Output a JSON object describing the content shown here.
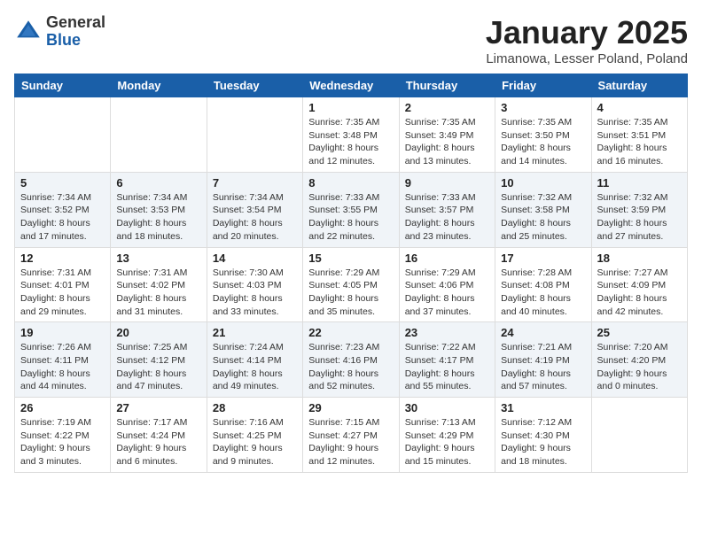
{
  "header": {
    "logo_general": "General",
    "logo_blue": "Blue",
    "title": "January 2025",
    "location": "Limanowa, Lesser Poland, Poland"
  },
  "days_of_week": [
    "Sunday",
    "Monday",
    "Tuesday",
    "Wednesday",
    "Thursday",
    "Friday",
    "Saturday"
  ],
  "weeks": [
    [
      {
        "day": "",
        "info": ""
      },
      {
        "day": "",
        "info": ""
      },
      {
        "day": "",
        "info": ""
      },
      {
        "day": "1",
        "info": "Sunrise: 7:35 AM\nSunset: 3:48 PM\nDaylight: 8 hours\nand 12 minutes."
      },
      {
        "day": "2",
        "info": "Sunrise: 7:35 AM\nSunset: 3:49 PM\nDaylight: 8 hours\nand 13 minutes."
      },
      {
        "day": "3",
        "info": "Sunrise: 7:35 AM\nSunset: 3:50 PM\nDaylight: 8 hours\nand 14 minutes."
      },
      {
        "day": "4",
        "info": "Sunrise: 7:35 AM\nSunset: 3:51 PM\nDaylight: 8 hours\nand 16 minutes."
      }
    ],
    [
      {
        "day": "5",
        "info": "Sunrise: 7:34 AM\nSunset: 3:52 PM\nDaylight: 8 hours\nand 17 minutes."
      },
      {
        "day": "6",
        "info": "Sunrise: 7:34 AM\nSunset: 3:53 PM\nDaylight: 8 hours\nand 18 minutes."
      },
      {
        "day": "7",
        "info": "Sunrise: 7:34 AM\nSunset: 3:54 PM\nDaylight: 8 hours\nand 20 minutes."
      },
      {
        "day": "8",
        "info": "Sunrise: 7:33 AM\nSunset: 3:55 PM\nDaylight: 8 hours\nand 22 minutes."
      },
      {
        "day": "9",
        "info": "Sunrise: 7:33 AM\nSunset: 3:57 PM\nDaylight: 8 hours\nand 23 minutes."
      },
      {
        "day": "10",
        "info": "Sunrise: 7:32 AM\nSunset: 3:58 PM\nDaylight: 8 hours\nand 25 minutes."
      },
      {
        "day": "11",
        "info": "Sunrise: 7:32 AM\nSunset: 3:59 PM\nDaylight: 8 hours\nand 27 minutes."
      }
    ],
    [
      {
        "day": "12",
        "info": "Sunrise: 7:31 AM\nSunset: 4:01 PM\nDaylight: 8 hours\nand 29 minutes."
      },
      {
        "day": "13",
        "info": "Sunrise: 7:31 AM\nSunset: 4:02 PM\nDaylight: 8 hours\nand 31 minutes."
      },
      {
        "day": "14",
        "info": "Sunrise: 7:30 AM\nSunset: 4:03 PM\nDaylight: 8 hours\nand 33 minutes."
      },
      {
        "day": "15",
        "info": "Sunrise: 7:29 AM\nSunset: 4:05 PM\nDaylight: 8 hours\nand 35 minutes."
      },
      {
        "day": "16",
        "info": "Sunrise: 7:29 AM\nSunset: 4:06 PM\nDaylight: 8 hours\nand 37 minutes."
      },
      {
        "day": "17",
        "info": "Sunrise: 7:28 AM\nSunset: 4:08 PM\nDaylight: 8 hours\nand 40 minutes."
      },
      {
        "day": "18",
        "info": "Sunrise: 7:27 AM\nSunset: 4:09 PM\nDaylight: 8 hours\nand 42 minutes."
      }
    ],
    [
      {
        "day": "19",
        "info": "Sunrise: 7:26 AM\nSunset: 4:11 PM\nDaylight: 8 hours\nand 44 minutes."
      },
      {
        "day": "20",
        "info": "Sunrise: 7:25 AM\nSunset: 4:12 PM\nDaylight: 8 hours\nand 47 minutes."
      },
      {
        "day": "21",
        "info": "Sunrise: 7:24 AM\nSunset: 4:14 PM\nDaylight: 8 hours\nand 49 minutes."
      },
      {
        "day": "22",
        "info": "Sunrise: 7:23 AM\nSunset: 4:16 PM\nDaylight: 8 hours\nand 52 minutes."
      },
      {
        "day": "23",
        "info": "Sunrise: 7:22 AM\nSunset: 4:17 PM\nDaylight: 8 hours\nand 55 minutes."
      },
      {
        "day": "24",
        "info": "Sunrise: 7:21 AM\nSunset: 4:19 PM\nDaylight: 8 hours\nand 57 minutes."
      },
      {
        "day": "25",
        "info": "Sunrise: 7:20 AM\nSunset: 4:20 PM\nDaylight: 9 hours\nand 0 minutes."
      }
    ],
    [
      {
        "day": "26",
        "info": "Sunrise: 7:19 AM\nSunset: 4:22 PM\nDaylight: 9 hours\nand 3 minutes."
      },
      {
        "day": "27",
        "info": "Sunrise: 7:17 AM\nSunset: 4:24 PM\nDaylight: 9 hours\nand 6 minutes."
      },
      {
        "day": "28",
        "info": "Sunrise: 7:16 AM\nSunset: 4:25 PM\nDaylight: 9 hours\nand 9 minutes."
      },
      {
        "day": "29",
        "info": "Sunrise: 7:15 AM\nSunset: 4:27 PM\nDaylight: 9 hours\nand 12 minutes."
      },
      {
        "day": "30",
        "info": "Sunrise: 7:13 AM\nSunset: 4:29 PM\nDaylight: 9 hours\nand 15 minutes."
      },
      {
        "day": "31",
        "info": "Sunrise: 7:12 AM\nSunset: 4:30 PM\nDaylight: 9 hours\nand 18 minutes."
      },
      {
        "day": "",
        "info": ""
      }
    ]
  ]
}
